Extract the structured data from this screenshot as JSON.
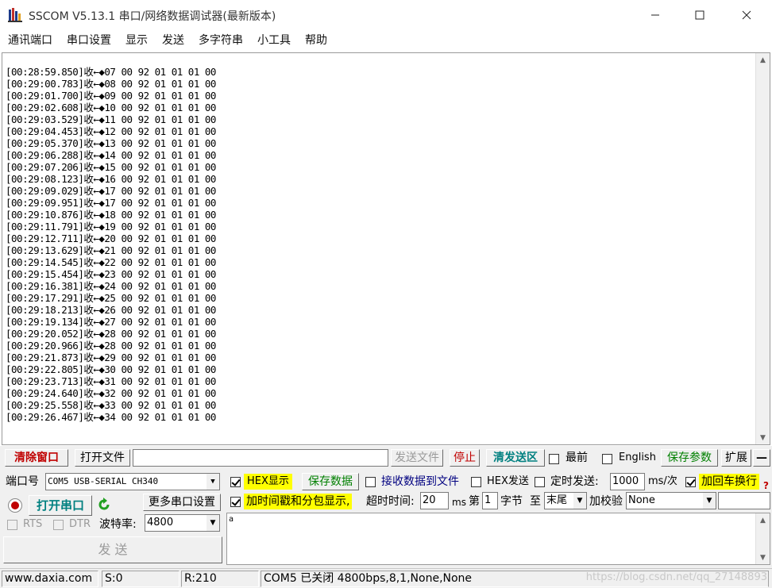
{
  "window": {
    "title": "SSCOM V5.13.1 串口/网络数据调试器(最新版本)"
  },
  "menu": [
    "通讯端口",
    "串口设置",
    "显示",
    "发送",
    "多字符串",
    "小工具",
    "帮助"
  ],
  "receive": {
    "lines": [
      "[00:28:59.850]收←◆07 00 92 01 01 01 00",
      "[00:29:00.783]收←◆08 00 92 01 01 01 00",
      "[00:29:01.700]收←◆09 00 92 01 01 01 00",
      "[00:29:02.608]收←◆10 00 92 01 01 01 00",
      "[00:29:03.529]收←◆11 00 92 01 01 01 00",
      "[00:29:04.453]收←◆12 00 92 01 01 01 00",
      "[00:29:05.370]收←◆13 00 92 01 01 01 00",
      "[00:29:06.288]收←◆14 00 92 01 01 01 00",
      "[00:29:07.206]收←◆15 00 92 01 01 01 00",
      "[00:29:08.123]收←◆16 00 92 01 01 01 00",
      "[00:29:09.029]收←◆17 00 92 01 01 01 00",
      "[00:29:09.951]收←◆17 00 92 01 01 01 00",
      "[00:29:10.876]收←◆18 00 92 01 01 01 00",
      "[00:29:11.791]收←◆19 00 92 01 01 01 00",
      "[00:29:12.711]收←◆20 00 92 01 01 01 00",
      "[00:29:13.629]收←◆21 00 92 01 01 01 00",
      "[00:29:14.545]收←◆22 00 92 01 01 01 00",
      "[00:29:15.454]收←◆23 00 92 01 01 01 00",
      "[00:29:16.381]收←◆24 00 92 01 01 01 00",
      "[00:29:17.291]收←◆25 00 92 01 01 01 00",
      "[00:29:18.213]收←◆26 00 92 01 01 01 00",
      "[00:29:19.134]收←◆27 00 92 01 01 01 00",
      "[00:29:20.052]收←◆28 00 92 01 01 01 00",
      "[00:29:20.966]收←◆28 00 92 01 01 01 00",
      "[00:29:21.873]收←◆29 00 92 01 01 01 00",
      "[00:29:22.805]收←◆30 00 92 01 01 01 00",
      "[00:29:23.713]收←◆31 00 92 01 01 01 00",
      "[00:29:24.640]收←◆32 00 92 01 01 01 00",
      "[00:29:25.558]收←◆33 00 92 01 01 01 00",
      "[00:29:26.467]收←◆34 00 92 01 01 01 00"
    ]
  },
  "toolbar": {
    "clear_window": "清除窗口",
    "open_file": "打开文件",
    "file_path": "",
    "send_file": "发送文件",
    "stop": "停止",
    "clear_send": "清发送区",
    "topmost": "最前",
    "english": "English",
    "save_params": "保存参数",
    "expand": "扩展",
    "collapse": "—"
  },
  "port": {
    "port_label": "端口号",
    "port_value": "COM5 USB-SERIAL CH340",
    "open_port": "打开串口",
    "more_settings": "更多串口设置",
    "rts": "RTS",
    "dtr": "DTR",
    "baud_label": "波特率:",
    "baud_value": "4800"
  },
  "options": {
    "hex_display": "HEX显示",
    "save_data": "保存数据",
    "recv_to_file": "接收数据到文件",
    "hex_send": "HEX发送",
    "timed_send": "定时发送:",
    "interval": "1000",
    "interval_unit": "ms/次",
    "add_crlf": "加回车换行",
    "timestamp": "加时间戳和分包显示,",
    "timeout_label": "超时时间:",
    "timeout_value": "20",
    "timeout_unit": "ms",
    "byte_prefix": "第",
    "byte_value": "1",
    "byte_suffix": "字节",
    "to_label": "至",
    "to_value": "末尾",
    "checksum_label": "加校验",
    "checksum_value": "None",
    "help_mark": "?"
  },
  "send": {
    "button": "发  送",
    "text": "a"
  },
  "status": {
    "website": "www.daxia.com",
    "sent": "S:0",
    "received": "R:210",
    "port_status": "COM5 已关闭  4800bps,8,1,None,None",
    "watermark": "https://blog.csdn.net/qq_27148893"
  },
  "colors": {
    "hex_highlight": "#ffff00",
    "open_port_text": "#008080",
    "stop_text": "#c00000",
    "clear_send_text": "#008080"
  }
}
